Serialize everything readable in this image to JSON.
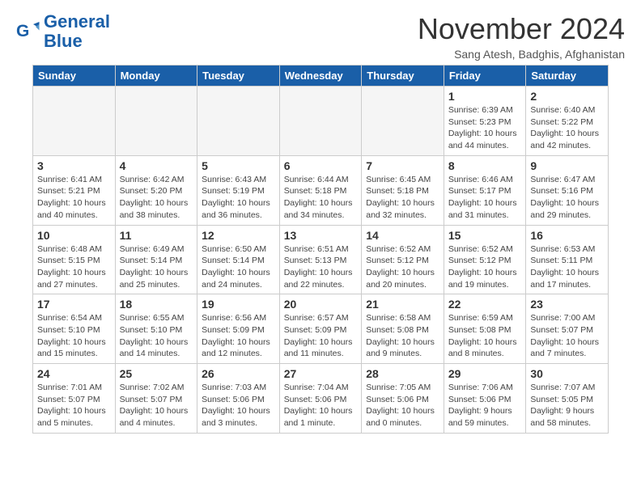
{
  "header": {
    "logo_line1": "General",
    "logo_line2": "Blue",
    "month_title": "November 2024",
    "location": "Sang Atesh, Badghis, Afghanistan"
  },
  "days_of_week": [
    "Sunday",
    "Monday",
    "Tuesday",
    "Wednesday",
    "Thursday",
    "Friday",
    "Saturday"
  ],
  "weeks": [
    [
      {
        "num": "",
        "info": ""
      },
      {
        "num": "",
        "info": ""
      },
      {
        "num": "",
        "info": ""
      },
      {
        "num": "",
        "info": ""
      },
      {
        "num": "",
        "info": ""
      },
      {
        "num": "1",
        "info": "Sunrise: 6:39 AM\nSunset: 5:23 PM\nDaylight: 10 hours and 44 minutes."
      },
      {
        "num": "2",
        "info": "Sunrise: 6:40 AM\nSunset: 5:22 PM\nDaylight: 10 hours and 42 minutes."
      }
    ],
    [
      {
        "num": "3",
        "info": "Sunrise: 6:41 AM\nSunset: 5:21 PM\nDaylight: 10 hours and 40 minutes."
      },
      {
        "num": "4",
        "info": "Sunrise: 6:42 AM\nSunset: 5:20 PM\nDaylight: 10 hours and 38 minutes."
      },
      {
        "num": "5",
        "info": "Sunrise: 6:43 AM\nSunset: 5:19 PM\nDaylight: 10 hours and 36 minutes."
      },
      {
        "num": "6",
        "info": "Sunrise: 6:44 AM\nSunset: 5:18 PM\nDaylight: 10 hours and 34 minutes."
      },
      {
        "num": "7",
        "info": "Sunrise: 6:45 AM\nSunset: 5:18 PM\nDaylight: 10 hours and 32 minutes."
      },
      {
        "num": "8",
        "info": "Sunrise: 6:46 AM\nSunset: 5:17 PM\nDaylight: 10 hours and 31 minutes."
      },
      {
        "num": "9",
        "info": "Sunrise: 6:47 AM\nSunset: 5:16 PM\nDaylight: 10 hours and 29 minutes."
      }
    ],
    [
      {
        "num": "10",
        "info": "Sunrise: 6:48 AM\nSunset: 5:15 PM\nDaylight: 10 hours and 27 minutes."
      },
      {
        "num": "11",
        "info": "Sunrise: 6:49 AM\nSunset: 5:14 PM\nDaylight: 10 hours and 25 minutes."
      },
      {
        "num": "12",
        "info": "Sunrise: 6:50 AM\nSunset: 5:14 PM\nDaylight: 10 hours and 24 minutes."
      },
      {
        "num": "13",
        "info": "Sunrise: 6:51 AM\nSunset: 5:13 PM\nDaylight: 10 hours and 22 minutes."
      },
      {
        "num": "14",
        "info": "Sunrise: 6:52 AM\nSunset: 5:12 PM\nDaylight: 10 hours and 20 minutes."
      },
      {
        "num": "15",
        "info": "Sunrise: 6:52 AM\nSunset: 5:12 PM\nDaylight: 10 hours and 19 minutes."
      },
      {
        "num": "16",
        "info": "Sunrise: 6:53 AM\nSunset: 5:11 PM\nDaylight: 10 hours and 17 minutes."
      }
    ],
    [
      {
        "num": "17",
        "info": "Sunrise: 6:54 AM\nSunset: 5:10 PM\nDaylight: 10 hours and 15 minutes."
      },
      {
        "num": "18",
        "info": "Sunrise: 6:55 AM\nSunset: 5:10 PM\nDaylight: 10 hours and 14 minutes."
      },
      {
        "num": "19",
        "info": "Sunrise: 6:56 AM\nSunset: 5:09 PM\nDaylight: 10 hours and 12 minutes."
      },
      {
        "num": "20",
        "info": "Sunrise: 6:57 AM\nSunset: 5:09 PM\nDaylight: 10 hours and 11 minutes."
      },
      {
        "num": "21",
        "info": "Sunrise: 6:58 AM\nSunset: 5:08 PM\nDaylight: 10 hours and 9 minutes."
      },
      {
        "num": "22",
        "info": "Sunrise: 6:59 AM\nSunset: 5:08 PM\nDaylight: 10 hours and 8 minutes."
      },
      {
        "num": "23",
        "info": "Sunrise: 7:00 AM\nSunset: 5:07 PM\nDaylight: 10 hours and 7 minutes."
      }
    ],
    [
      {
        "num": "24",
        "info": "Sunrise: 7:01 AM\nSunset: 5:07 PM\nDaylight: 10 hours and 5 minutes."
      },
      {
        "num": "25",
        "info": "Sunrise: 7:02 AM\nSunset: 5:07 PM\nDaylight: 10 hours and 4 minutes."
      },
      {
        "num": "26",
        "info": "Sunrise: 7:03 AM\nSunset: 5:06 PM\nDaylight: 10 hours and 3 minutes."
      },
      {
        "num": "27",
        "info": "Sunrise: 7:04 AM\nSunset: 5:06 PM\nDaylight: 10 hours and 1 minute."
      },
      {
        "num": "28",
        "info": "Sunrise: 7:05 AM\nSunset: 5:06 PM\nDaylight: 10 hours and 0 minutes."
      },
      {
        "num": "29",
        "info": "Sunrise: 7:06 AM\nSunset: 5:06 PM\nDaylight: 9 hours and 59 minutes."
      },
      {
        "num": "30",
        "info": "Sunrise: 7:07 AM\nSunset: 5:05 PM\nDaylight: 9 hours and 58 minutes."
      }
    ]
  ]
}
